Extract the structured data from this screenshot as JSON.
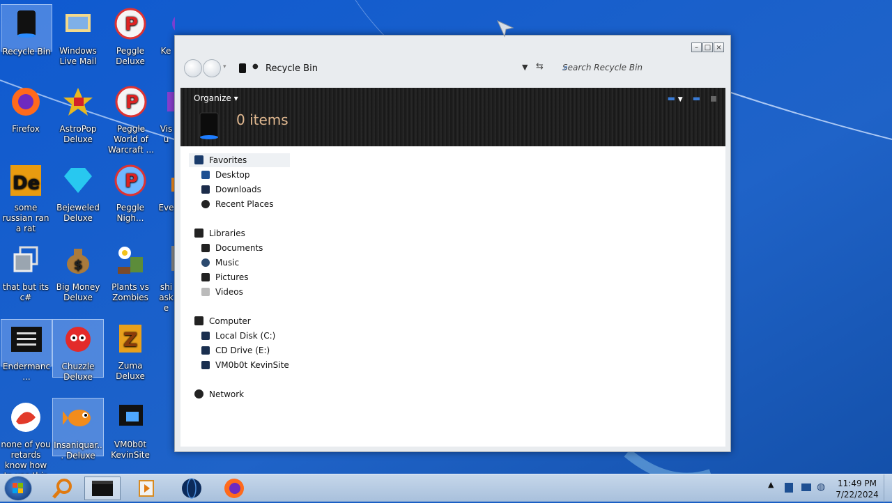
{
  "desktop": {
    "icons": [
      {
        "label": "Recycle Bin"
      },
      {
        "label": "Windows Live Mail"
      },
      {
        "label": "Peggle Deluxe"
      },
      {
        "label": "Ke"
      },
      {
        "label": "Firefox"
      },
      {
        "label": "AstroPop Deluxe"
      },
      {
        "label": "Peggle World of Warcraft ..."
      },
      {
        "label": "Visu"
      },
      {
        "label": "some russian ran a rat"
      },
      {
        "label": "Bejeweled Deluxe"
      },
      {
        "label": "Peggle Nigh..."
      },
      {
        "label": "Eve"
      },
      {
        "label": "that but its c#"
      },
      {
        "label": "Big Money Deluxe"
      },
      {
        "label": "Plants vs Zombies"
      },
      {
        "label": "shi aske"
      },
      {
        "label": "Endermanc..."
      },
      {
        "label": "Chuzzle Deluxe"
      },
      {
        "label": "Zuma Deluxe"
      },
      {
        "label": "none of you retards know how to use this"
      },
      {
        "label": "Insaniquar... Deluxe"
      },
      {
        "label": "VM0b0t KevinSite"
      }
    ]
  },
  "window": {
    "title": "Recycle Bin",
    "search_placeholder": "Search Recycle Bin",
    "toolbar": {
      "organize_label": "Organize ▾",
      "item_count": "0 items"
    },
    "nav": {
      "favorites": {
        "label": "Favorites",
        "items": [
          "Desktop",
          "Downloads",
          "Recent Places"
        ]
      },
      "libraries": {
        "label": "Libraries",
        "items": [
          "Documents",
          "Music",
          "Pictures",
          "Videos"
        ]
      },
      "computer": {
        "label": "Computer",
        "items": [
          "Local Disk (C:)",
          "CD Drive (E:)",
          "VM0b0t KevinSite"
        ]
      },
      "network": {
        "label": "Network"
      }
    }
  },
  "taskbar": {
    "clock_time": "11:49 PM",
    "clock_date": "7/22/2024"
  },
  "colors": {
    "accent": "#1a5fc4",
    "itemcount": "#e0b890"
  }
}
